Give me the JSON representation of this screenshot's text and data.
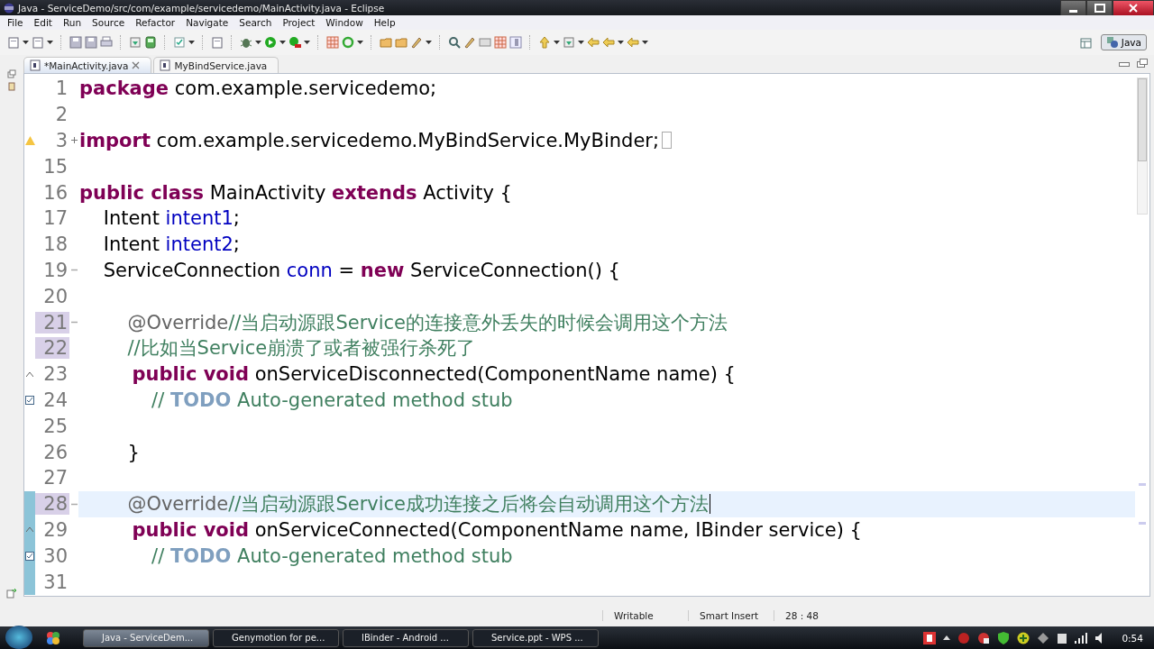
{
  "window": {
    "title": "Java - ServiceDemo/src/com/example/servicedemo/MainActivity.java - Eclipse"
  },
  "menu": [
    "File",
    "Edit",
    "Run",
    "Source",
    "Refactor",
    "Navigate",
    "Search",
    "Project",
    "Window",
    "Help"
  ],
  "perspective": {
    "label": "Java",
    "selected": true
  },
  "tabs": [
    {
      "label": "*MainActivity.java",
      "selected": true
    },
    {
      "label": "MyBindService.java",
      "selected": false
    }
  ],
  "code": [
    {
      "number": "1",
      "kind": "plain",
      "highlighted": false,
      "current": false,
      "changed": false,
      "segments": [
        {
          "kind": "keyword",
          "text": "package"
        },
        {
          "kind": "plain",
          "text": " com.example.servicedemo;"
        }
      ]
    },
    {
      "number": "2",
      "kind": "plain",
      "highlighted": false,
      "current": false,
      "changed": false
    },
    {
      "number": "3",
      "kind": "folded_warning",
      "highlighted": false,
      "current": false,
      "changed": false,
      "segments": [
        {
          "kind": "keyword",
          "text": "import"
        },
        {
          "kind": "plain",
          "text": " com.example.servicedemo.MyBindService.MyBinder;"
        }
      ]
    },
    {
      "number": "15",
      "kind": "plain",
      "highlighted": false,
      "current": false,
      "changed": false
    },
    {
      "number": "16",
      "kind": "plain",
      "highlighted": false,
      "current": false,
      "changed": false,
      "segments": [
        {
          "kind": "keyword",
          "text": "public class"
        },
        {
          "kind": "plain",
          "text": " MainActivity "
        },
        {
          "kind": "keyword",
          "text": "extends"
        },
        {
          "kind": "plain",
          "text": " Activity {"
        }
      ]
    },
    {
      "number": "17",
      "kind": "plain",
      "highlighted": false,
      "current": false,
      "changed": false,
      "segments": [
        {
          "kind": "plain",
          "text": "    Intent "
        },
        {
          "kind": "field",
          "text": "intent1"
        },
        {
          "kind": "plain",
          "text": ";"
        }
      ]
    },
    {
      "number": "18",
      "kind": "plain",
      "highlighted": false,
      "current": false,
      "changed": false,
      "segments": [
        {
          "kind": "plain",
          "text": "    Intent "
        },
        {
          "kind": "field",
          "text": "intent2"
        },
        {
          "kind": "plain",
          "text": ";"
        }
      ]
    },
    {
      "number": "19",
      "kind": "fold_start",
      "highlighted": false,
      "current": false,
      "changed": false,
      "segments": [
        {
          "kind": "plain",
          "text": "    ServiceConnection "
        },
        {
          "kind": "field",
          "text": "conn"
        },
        {
          "kind": "plain",
          "text": " = "
        },
        {
          "kind": "keyword",
          "text": "new"
        },
        {
          "kind": "plain",
          "text": " ServiceConnection() {"
        }
      ]
    },
    {
      "number": "20",
      "kind": "plain",
      "highlighted": false,
      "current": false,
      "changed": false
    },
    {
      "number": "21",
      "kind": "fold_start",
      "highlighted": true,
      "current": false,
      "changed": false,
      "segments": [
        {
          "kind": "annotation",
          "text": "        @Override"
        },
        {
          "kind": "comment",
          "text": "//当启动源跟Service的连接意外丢失的时候会调用这个方法"
        }
      ]
    },
    {
      "number": "22",
      "kind": "plain",
      "highlighted": true,
      "current": false,
      "changed": false,
      "segments": [
        {
          "kind": "comment",
          "text": "        //比如当Service崩溃了或者被强行杀死了"
        }
      ]
    },
    {
      "number": "23",
      "kind": "override",
      "highlighted": false,
      "current": false,
      "changed": false,
      "segments": [
        {
          "kind": "keyword",
          "text": "        public void"
        },
        {
          "kind": "plain",
          "text": " onServiceDisconnected(ComponentName name) {"
        }
      ]
    },
    {
      "number": "24",
      "kind": "task",
      "highlighted": false,
      "current": false,
      "changed": false,
      "segments": [
        {
          "kind": "comment",
          "text": "            // "
        },
        {
          "kind": "todo",
          "text": "TODO"
        },
        {
          "kind": "comment",
          "text": " Auto-generated method stub"
        }
      ]
    },
    {
      "number": "25",
      "kind": "plain",
      "highlighted": false,
      "current": false,
      "changed": false
    },
    {
      "number": "26",
      "kind": "plain",
      "highlighted": false,
      "current": false,
      "changed": false,
      "segments": [
        {
          "kind": "plain",
          "text": "        }"
        }
      ]
    },
    {
      "number": "27",
      "kind": "plain",
      "highlighted": false,
      "current": false,
      "changed": false
    },
    {
      "number": "28",
      "kind": "fold_start",
      "highlighted": true,
      "current": true,
      "changed": true,
      "segments": [
        {
          "kind": "annotation",
          "text": "        @Override"
        },
        {
          "kind": "comment",
          "text": "//当启动源跟Service成功连接之后将会自动调用这个方法"
        }
      ]
    },
    {
      "number": "29",
      "kind": "override",
      "highlighted": false,
      "current": false,
      "changed": true,
      "segments": [
        {
          "kind": "keyword",
          "text": "        public void"
        },
        {
          "kind": "plain",
          "text": " onServiceConnected(ComponentName name, IBinder service) {"
        }
      ]
    },
    {
      "number": "30",
      "kind": "task",
      "highlighted": false,
      "current": false,
      "changed": true,
      "segments": [
        {
          "kind": "comment",
          "text": "            // "
        },
        {
          "kind": "todo",
          "text": "TODO"
        },
        {
          "kind": "comment",
          "text": " Auto-generated method stub"
        }
      ]
    },
    {
      "number": "31",
      "kind": "plain",
      "highlighted": false,
      "current": false,
      "changed": true
    }
  ],
  "status_bar": [
    "Writable",
    "Smart Insert",
    "28 : 48"
  ],
  "taskbar": {
    "items": [
      {
        "label": "Java - ServiceDem...",
        "selected": true
      },
      {
        "label": "Genymotion for pe...",
        "selected": false
      },
      {
        "label": "IBinder - Android ...",
        "selected": false
      },
      {
        "label": "Service.ppt - WPS ...",
        "selected": false
      }
    ],
    "clock": "0:54"
  }
}
